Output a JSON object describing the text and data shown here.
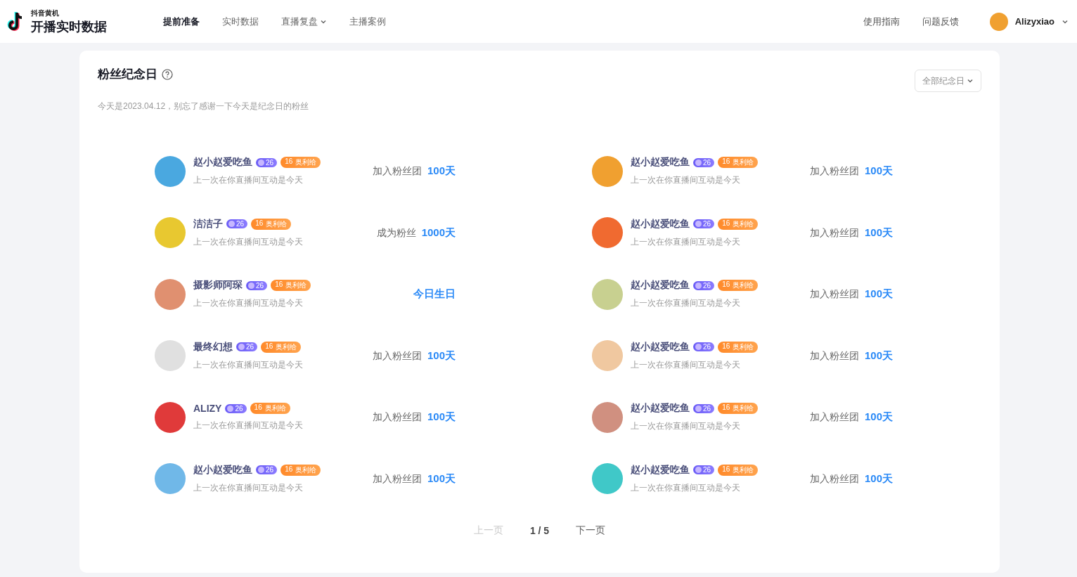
{
  "brand": {
    "small": "抖音黄机",
    "title": "开播实时数据"
  },
  "nav": [
    {
      "label": "提前准备",
      "selected": true,
      "has_menu": false
    },
    {
      "label": "实时数据",
      "selected": false,
      "has_menu": false
    },
    {
      "label": "直播复盘",
      "selected": false,
      "has_menu": true
    },
    {
      "label": "主播案例",
      "selected": false,
      "has_menu": false
    }
  ],
  "header_links": [
    "使用指南",
    "问题反馈"
  ],
  "user": {
    "name": "Alizyxiao"
  },
  "card": {
    "title": "粉丝纪念日",
    "subtitle": "今天是2023.04.12，别忘了感谢一下今天是纪念日的粉丝",
    "filter": "全部纪念日"
  },
  "fans": [
    {
      "name": "赵小赵爱吃鱼",
      "level": "26",
      "club_level": "16",
      "club": "奥利给",
      "note": "上一次在你直播间互动是今天",
      "label": "加入粉丝团",
      "value": "100天"
    },
    {
      "name": "赵小赵爱吃鱼",
      "level": "26",
      "club_level": "16",
      "club": "奥利给",
      "note": "上一次在你直播间互动是今天",
      "label": "加入粉丝团",
      "value": "100天"
    },
    {
      "name": "洁洁子",
      "level": "26",
      "club_level": "16",
      "club": "奥利给",
      "note": "上一次在你直播间互动是今天",
      "label": "成为粉丝",
      "value": "1000天"
    },
    {
      "name": "赵小赵爱吃鱼",
      "level": "26",
      "club_level": "16",
      "club": "奥利给",
      "note": "上一次在你直播间互动是今天",
      "label": "加入粉丝团",
      "value": "100天"
    },
    {
      "name": "摄影师阿琛",
      "level": "26",
      "club_level": "16",
      "club": "奥利给",
      "note": "上一次在你直播间互动是今天",
      "value": "今日生日"
    },
    {
      "name": "赵小赵爱吃鱼",
      "level": "26",
      "club_level": "16",
      "club": "奥利给",
      "note": "上一次在你直播间互动是今天",
      "label": "加入粉丝团",
      "value": "100天"
    },
    {
      "name": "最终幻想",
      "level": "26",
      "club_level": "16",
      "club": "奥利给",
      "note": "上一次在你直播间互动是今天",
      "label": "加入粉丝团",
      "value": "100天"
    },
    {
      "name": "赵小赵爱吃鱼",
      "level": "26",
      "club_level": "16",
      "club": "奥利给",
      "note": "上一次在你直播间互动是今天",
      "label": "加入粉丝团",
      "value": "100天"
    },
    {
      "name": "ALIZY",
      "level": "26",
      "club_level": "16",
      "club": "奥利给",
      "note": "上一次在你直播间互动是今天",
      "label": "加入粉丝团",
      "value": "100天"
    },
    {
      "name": "赵小赵爱吃鱼",
      "level": "26",
      "club_level": "16",
      "club": "奥利给",
      "note": "上一次在你直播间互动是今天",
      "label": "加入粉丝团",
      "value": "100天"
    },
    {
      "name": "赵小赵爱吃鱼",
      "level": "26",
      "club_level": "16",
      "club": "奥利给",
      "note": "上一次在你直播间互动是今天",
      "label": "加入粉丝团",
      "value": "100天"
    },
    {
      "name": "赵小赵爱吃鱼",
      "level": "26",
      "club_level": "16",
      "club": "奥利给",
      "note": "上一次在你直播间互动是今天",
      "label": "加入粉丝团",
      "value": "100天"
    }
  ],
  "pagination": {
    "prev": {
      "label": "上一页",
      "disabled": true
    },
    "page": "1 / 5",
    "next": {
      "label": "下一页",
      "disabled": false
    }
  }
}
